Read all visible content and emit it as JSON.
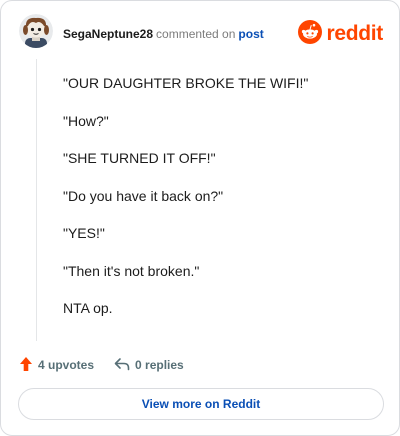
{
  "header": {
    "username": "SegaNeptune28",
    "action_text": "commented on",
    "post_link": "post",
    "logo_word": "reddit"
  },
  "comment": {
    "lines": [
      "\"OUR DAUGHTER BROKE THE WIFI!\"",
      "\"How?\"",
      "\"SHE TURNED IT OFF!\"",
      "\"Do you have it back on?\"",
      "\"YES!\"",
      "\"Then it's not broken.\"",
      "NTA op."
    ]
  },
  "actions": {
    "upvotes": "4 upvotes",
    "replies": "0 replies"
  },
  "footer": {
    "view_more": "View more on Reddit"
  },
  "colors": {
    "brand": "#ff4500",
    "link": "#0a4fb5",
    "muted": "#576f76"
  },
  "icons": {
    "avatar": "snoo-avatar",
    "logo": "reddit-snoo-icon",
    "upvote": "upvote-arrow-icon",
    "reply": "reply-arrow-icon"
  }
}
